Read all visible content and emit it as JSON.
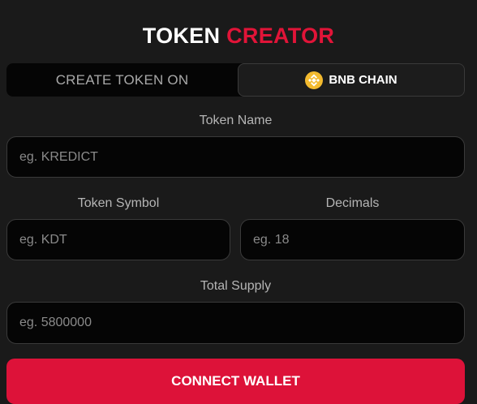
{
  "header": {
    "title_part1": "TOKEN",
    "title_part2": "CREATOR",
    "accent_color": "#e11438"
  },
  "chain": {
    "label": "CREATE TOKEN ON",
    "selected": "BNB CHAIN",
    "icon": "bnb-icon"
  },
  "form": {
    "token_name": {
      "label": "Token Name",
      "placeholder": "eg. KREDICT"
    },
    "token_symbol": {
      "label": "Token Symbol",
      "placeholder": "eg. KDT"
    },
    "decimals": {
      "label": "Decimals",
      "placeholder": "eg. 18"
    },
    "total_supply": {
      "label": "Total Supply",
      "placeholder": "eg. 5800000"
    }
  },
  "actions": {
    "connect_label": "CONNECT WALLET",
    "connect_color": "#dd1239"
  }
}
